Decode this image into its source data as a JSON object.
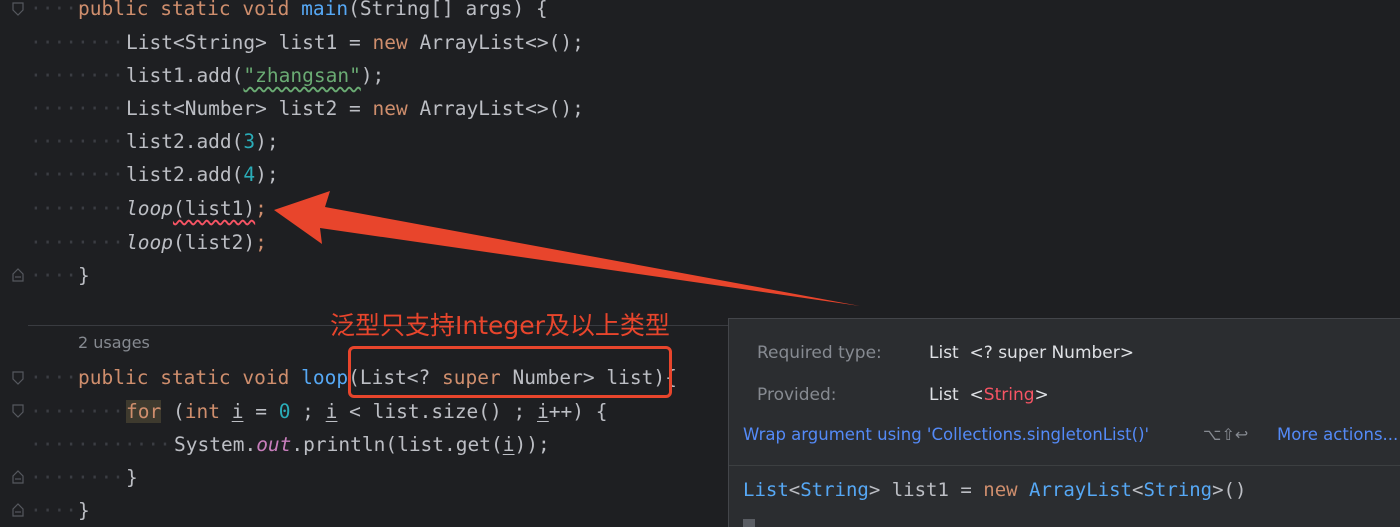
{
  "code": {
    "main_signature": {
      "kw1": "public",
      "kw2": "static",
      "kw3": "void",
      "name": "main",
      "params": "(String[] args) {"
    },
    "line1": {
      "type": "List<String> list1 = ",
      "kw": "new",
      "rest": " ArrayList<>();"
    },
    "line2": {
      "pre": "list1.add(",
      "str": "\"zhangsan\"",
      "post": ");"
    },
    "line3": {
      "type": "List<Number> list2 = ",
      "kw": "new",
      "rest": " ArrayList<>();"
    },
    "line4": {
      "pre": "list2.add(",
      "num": "3",
      "post": ");"
    },
    "line5": {
      "pre": "list2.add(",
      "num": "4",
      "post": ");"
    },
    "line6": {
      "call": "loop",
      "arg": "(list1)",
      "post": ";"
    },
    "line7": {
      "call": "loop",
      "arg": "(list2)",
      "post": ";"
    },
    "close_brace": "}",
    "usages": "2 usages",
    "loop_signature": {
      "kw1": "public",
      "kw2": "static",
      "kw3": "void",
      "name": "loop",
      "p1": "(List<? ",
      "super": "super",
      "p2": " Number> list){"
    },
    "for_line": {
      "kw": "for",
      "p1": " (",
      "int": "int",
      "sp": " ",
      "i1": "i",
      "p2": " = ",
      "zero": "0",
      "p3": " ; ",
      "i2": "i",
      "p4": " < list.size() ; ",
      "i3": "i",
      "p5": "++) {"
    },
    "print_line": {
      "p1": "System.",
      "out": "out",
      "p2": ".println(list.get(",
      "i": "i",
      "p3": "));"
    },
    "inner_close": "}",
    "outer_close": "}"
  },
  "annotation": {
    "text": "泛型只支持Integer及以上类型",
    "color": "#e8452c"
  },
  "popup": {
    "required_label": "Required type:",
    "required_value": "List  <? super Number>",
    "provided_label": "Provided:",
    "provided_list": "List  <",
    "provided_type": "String",
    "provided_end": ">",
    "action": "Wrap argument using 'Collections.singletonList()'",
    "shortcut": "⌥⇧↩",
    "more": "More actions...",
    "code_type1": "List",
    "code_p1": "<",
    "code_type2": "String",
    "code_p2": "> list1 = ",
    "code_kw": "new",
    "code_sp": " ",
    "code_type3": "ArrayList",
    "code_p3": "<",
    "code_type4": "String",
    "code_p4": ">()"
  },
  "colors": {
    "background": "#1e1f22",
    "keyword": "#cf8e6d",
    "function": "#56a8f5",
    "number": "#2aacb8",
    "string": "#6aab73",
    "error": "#f75464",
    "link": "#548af7"
  }
}
